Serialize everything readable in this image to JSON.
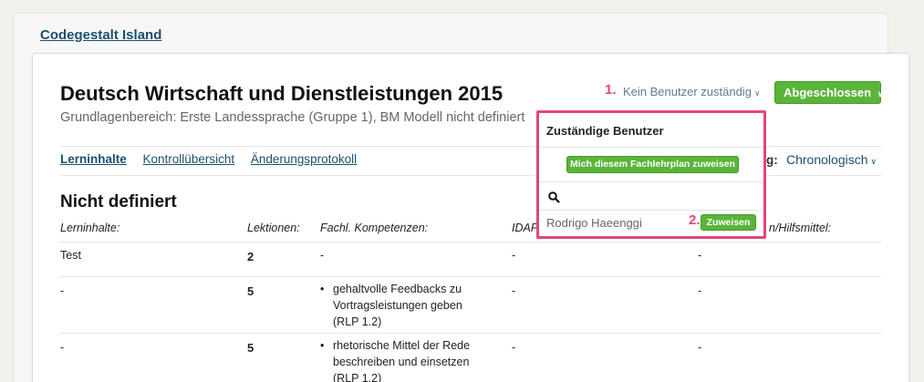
{
  "organization": "Codegestalt Island",
  "plan": {
    "title": "Deutsch Wirtschaft und Dienstleistungen 2015",
    "subtitle": "Grundlagenbereich: Erste Landessprache (Gruppe 1), BM Modell nicht definiert"
  },
  "header": {
    "step1": "1.",
    "assign_toggle": "Kein Benutzer zuständig",
    "status_button": "Abgeschlossen"
  },
  "tabs": [
    "Lerninhalte",
    "Kontrollübersicht",
    "Änderungsprotokoll"
  ],
  "sort": {
    "label": "g:",
    "value": "Chronologisch"
  },
  "popover": {
    "title": "Zuständige Benutzer",
    "assign_self_button": "Mich diesem Fachlehrplan zuweisen",
    "search_placeholder": "",
    "user_name": "Rodrigo Haeenggi",
    "step2": "2.",
    "assign_button": "Zuweisen"
  },
  "section": {
    "title": "Nicht definiert",
    "columns": [
      "Lerninhalte:",
      "Lektionen:",
      "Fachl. Kompetenzen:",
      "IDAF",
      "n/Hilfsmittel:"
    ],
    "rows": [
      {
        "content": "Test",
        "lessons": "2",
        "competencies": [
          "-"
        ],
        "idaf": "-",
        "aids": "-"
      },
      {
        "content": "-",
        "lessons": "5",
        "competencies": [
          "gehaltvolle Feedbacks zu",
          "Vortragsleistungen geben",
          "(RLP 1.2)"
        ],
        "idaf": "-",
        "aids": "-"
      },
      {
        "content": "-",
        "lessons": "5",
        "competencies": [
          "rhetorische Mittel der Rede",
          "beschreiben und einsetzen",
          "(RLP 1.2)"
        ],
        "idaf": "-",
        "aids": "-"
      }
    ]
  },
  "icons": {
    "search": "search-icon",
    "caret": "chevron-down-icon"
  },
  "colors": {
    "accent_green": "#5bb43a",
    "highlight_pink": "#e2467a",
    "link_blue": "#1c4f70"
  }
}
